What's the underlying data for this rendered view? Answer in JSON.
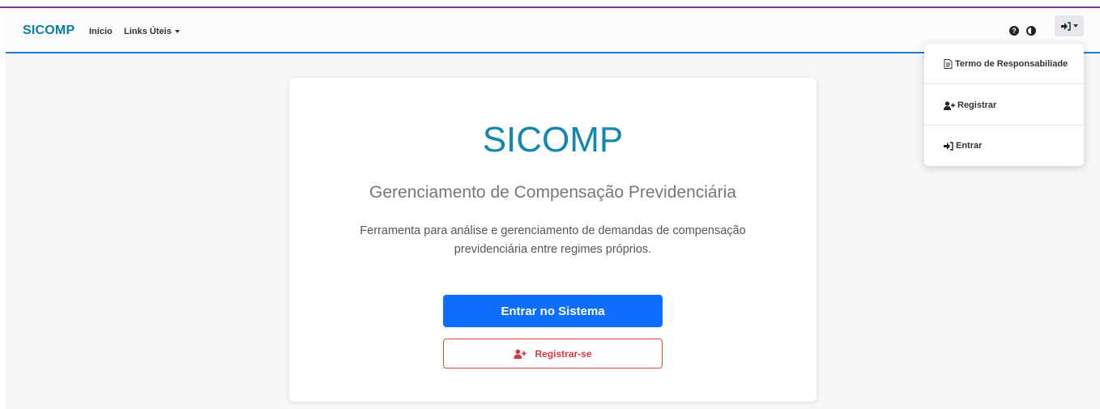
{
  "navbar": {
    "brand": "SICOMP",
    "links": [
      {
        "label": "Início"
      },
      {
        "label": "Links Úteis"
      }
    ],
    "icons": [
      "question-circle-icon",
      "contrast-icon",
      "sign-in-icon"
    ]
  },
  "user_menu": {
    "items": [
      {
        "label": "Termo de Responsabiliade",
        "icon": "file-text-icon"
      },
      {
        "label": "Registrar",
        "icon": "user-plus-icon"
      },
      {
        "label": "Entrar",
        "icon": "sign-in-icon"
      }
    ]
  },
  "card": {
    "title": "SICOMP",
    "subtitle": "Gerenciamento de Compensação Previdenciária",
    "description": "Ferramenta para análise e gerenciamento de demandas de compensação previdenciária entre regimes próprios.",
    "primary_button": "Entrar no Sistema",
    "secondary_button": "Registrar-se"
  },
  "colors": {
    "brand": "#0d7ea3",
    "primary": "#0d6efd",
    "danger": "#dc3545",
    "nav_border": "#1f7bd8"
  }
}
